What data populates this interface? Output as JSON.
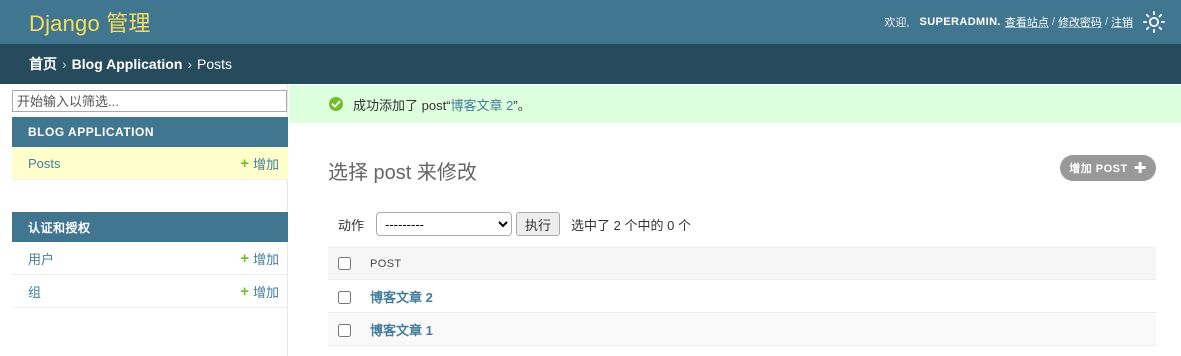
{
  "header": {
    "brand": "Django 管理",
    "welcome": "欢迎,",
    "username": "SUPERADMIN.",
    "links": [
      "查看站点",
      "修改密码",
      "注销"
    ]
  },
  "breadcrumbs": {
    "home": "首页",
    "app": "Blog Application",
    "current": "Posts"
  },
  "nav": {
    "filter_placeholder": "开始输入以筛选...",
    "modules": [
      {
        "caption": "BLOG APPLICATION",
        "models": [
          {
            "name": "Posts",
            "add": "增加"
          }
        ]
      },
      {
        "caption": "认证和授权",
        "models": [
          {
            "name": "用户",
            "add": "增加"
          },
          {
            "name": "组",
            "add": "增加"
          }
        ]
      }
    ]
  },
  "message": {
    "prefix": "成功添加了 post“",
    "link": "博客文章 2",
    "suffix": "”。"
  },
  "content": {
    "title": "选择 post 来修改",
    "add_button": "增加 POST",
    "action_label": "动作",
    "action_selected": "---------",
    "go_button": "执行",
    "selection_count": "选中了 2 个中的 0 个",
    "column_header": "POST",
    "rows": [
      "博客文章 2",
      "博客文章 1"
    ]
  },
  "colors": {
    "header_bg": "#417690",
    "breadcrumb_bg": "#264b5d",
    "brand": "#f5dd5d",
    "success_bg": "#ddffdd",
    "link": "#447e9b",
    "add_plus": "#70bf2b"
  }
}
